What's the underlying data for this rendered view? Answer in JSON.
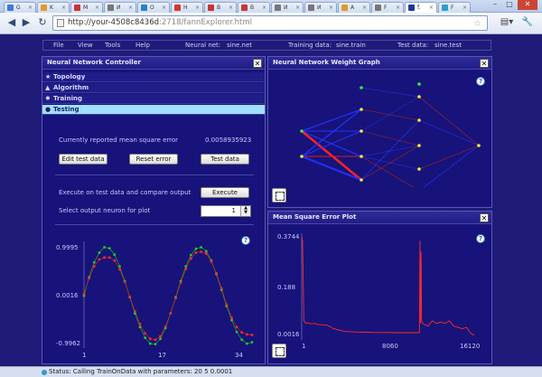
{
  "browser": {
    "tabs": [
      {
        "label": "G",
        "color": "#3b7be0"
      },
      {
        "label": "K",
        "color": "#e09b2a"
      },
      {
        "label": "M",
        "color": "#c33"
      },
      {
        "label": "И",
        "color": "#777"
      },
      {
        "label": "O",
        "color": "#2a7fd0"
      },
      {
        "label": "Н",
        "color": "#d33"
      },
      {
        "label": "В",
        "color": "#c33"
      },
      {
        "label": "В",
        "color": "#c33"
      },
      {
        "label": "И",
        "color": "#777"
      },
      {
        "label": "И",
        "color": "#777"
      },
      {
        "label": "A",
        "color": "#e09b2a"
      },
      {
        "label": "F",
        "color": "#777"
      },
      {
        "label": "f.",
        "color": "#1b3a9c"
      },
      {
        "label": "F",
        "color": "#2a9fd0"
      }
    ],
    "url_host": "http://your-4508c8436d",
    "url_path": ":2718/fannExplorer.html"
  },
  "menubar": {
    "file": "File",
    "view": "View",
    "tools": "Tools",
    "help": "Help",
    "neural_net_label": "Neural net:",
    "neural_net_value": "sine.net",
    "training_data_label": "Training data:",
    "training_data_value": "sine.train",
    "test_data_label": "Test data:",
    "test_data_value": "sine.test"
  },
  "controller": {
    "title": "Neural Network Controller",
    "sections": {
      "topology": "Topology",
      "algorithm": "Algorithm",
      "training": "Training",
      "testing": "Testing"
    },
    "mse_label": "Currently reported mean square error",
    "mse_value": "0.0058935923",
    "edit_test_data": "Edit test data",
    "reset_error": "Reset error",
    "test_data": "Test data",
    "execute_label": "Execute on test data and compare output",
    "execute_button": "Execute",
    "neuron_label": "Select output neuron for plot",
    "neuron_value": "1"
  },
  "output_plot": {
    "help": "?",
    "y_ticks": [
      "0.9995",
      "0.0016",
      "-0.9962"
    ],
    "x_ticks": [
      "1",
      "17",
      "34"
    ]
  },
  "weight_graph": {
    "title": "Neural Network Weight Graph",
    "help": "?"
  },
  "mse_plot": {
    "title": "Mean Square Error Plot",
    "help": "?",
    "y_ticks": [
      "0.3744",
      "0.188",
      "0.0016"
    ],
    "x_ticks": [
      "1",
      "8060",
      "16120"
    ]
  },
  "status": {
    "text": "Status:  Calling TrainOnData with parameters: 20 5 0.0001"
  },
  "chart_data": [
    {
      "type": "line",
      "title": "",
      "xlabel": "",
      "ylabel": "",
      "xlim": [
        1,
        34
      ],
      "ylim": [
        -0.9962,
        0.9995
      ],
      "grid": false,
      "series": [
        {
          "color": "#22cc22",
          "style": "points",
          "x": [
            1,
            2,
            3,
            4,
            5,
            6,
            7,
            8,
            9,
            10,
            11,
            12,
            13,
            14,
            15,
            16,
            17,
            18,
            19,
            20,
            21,
            22,
            23,
            24,
            25,
            26,
            27,
            28,
            29,
            30,
            31,
            32,
            33,
            34
          ],
          "y": [
            0.0,
            0.38,
            0.68,
            0.88,
            0.99,
            0.97,
            0.84,
            0.6,
            0.3,
            -0.03,
            -0.36,
            -0.64,
            -0.86,
            -0.98,
            -0.99,
            -0.88,
            -0.66,
            -0.36,
            -0.03,
            0.3,
            0.6,
            0.83,
            0.96,
            0.99,
            0.91,
            0.72,
            0.44,
            0.12,
            -0.21,
            -0.5,
            -0.74,
            -0.9,
            -0.98,
            -0.95
          ]
        },
        {
          "color": "#ff2a2a",
          "style": "points",
          "x": [
            1,
            2,
            3,
            4,
            5,
            6,
            7,
            8,
            9,
            10,
            11,
            12,
            13,
            14,
            15,
            16,
            17,
            18,
            19,
            20,
            21,
            22,
            23,
            24,
            25,
            26,
            27,
            28,
            29,
            30,
            31,
            32,
            33,
            34
          ],
          "y": [
            0.04,
            0.36,
            0.6,
            0.74,
            0.78,
            0.78,
            0.72,
            0.54,
            0.28,
            -0.02,
            -0.32,
            -0.58,
            -0.77,
            -0.88,
            -0.9,
            -0.83,
            -0.63,
            -0.36,
            -0.05,
            0.27,
            0.55,
            0.76,
            0.88,
            0.9,
            0.86,
            0.7,
            0.46,
            0.15,
            -0.18,
            -0.45,
            -0.64,
            -0.75,
            -0.79,
            -0.8
          ]
        }
      ]
    },
    {
      "type": "line",
      "title": "",
      "xlabel": "",
      "ylabel": "",
      "xlim": [
        1,
        16120
      ],
      "ylim": [
        0.0016,
        0.3744
      ],
      "grid": false,
      "series": [
        {
          "color": "#ff2a2a",
          "x": [
            1,
            80,
            200,
            400,
            600,
            900,
            1200,
            1500,
            1800,
            2400,
            3000,
            4000,
            5000,
            6000,
            7000,
            8000,
            9000,
            9600,
            10200,
            10800,
            11000,
            11050,
            11100,
            11150,
            11200,
            11300,
            11500,
            11800,
            12000,
            12200,
            12600,
            13000,
            13400,
            13800,
            14200,
            14600,
            15000,
            15400,
            15800,
            16120
          ],
          "y": [
            0.3744,
            0.36,
            0.06,
            0.05,
            0.052,
            0.048,
            0.05,
            0.046,
            0.045,
            0.043,
            0.03,
            0.02,
            0.018,
            0.017,
            0.016,
            0.016,
            0.015,
            0.015,
            0.015,
            0.015,
            0.016,
            0.36,
            0.05,
            0.32,
            0.06,
            0.05,
            0.045,
            0.04,
            0.05,
            0.06,
            0.05,
            0.055,
            0.05,
            0.06,
            0.04,
            0.035,
            0.03,
            0.035,
            0.012,
            0.006
          ]
        }
      ]
    }
  ]
}
